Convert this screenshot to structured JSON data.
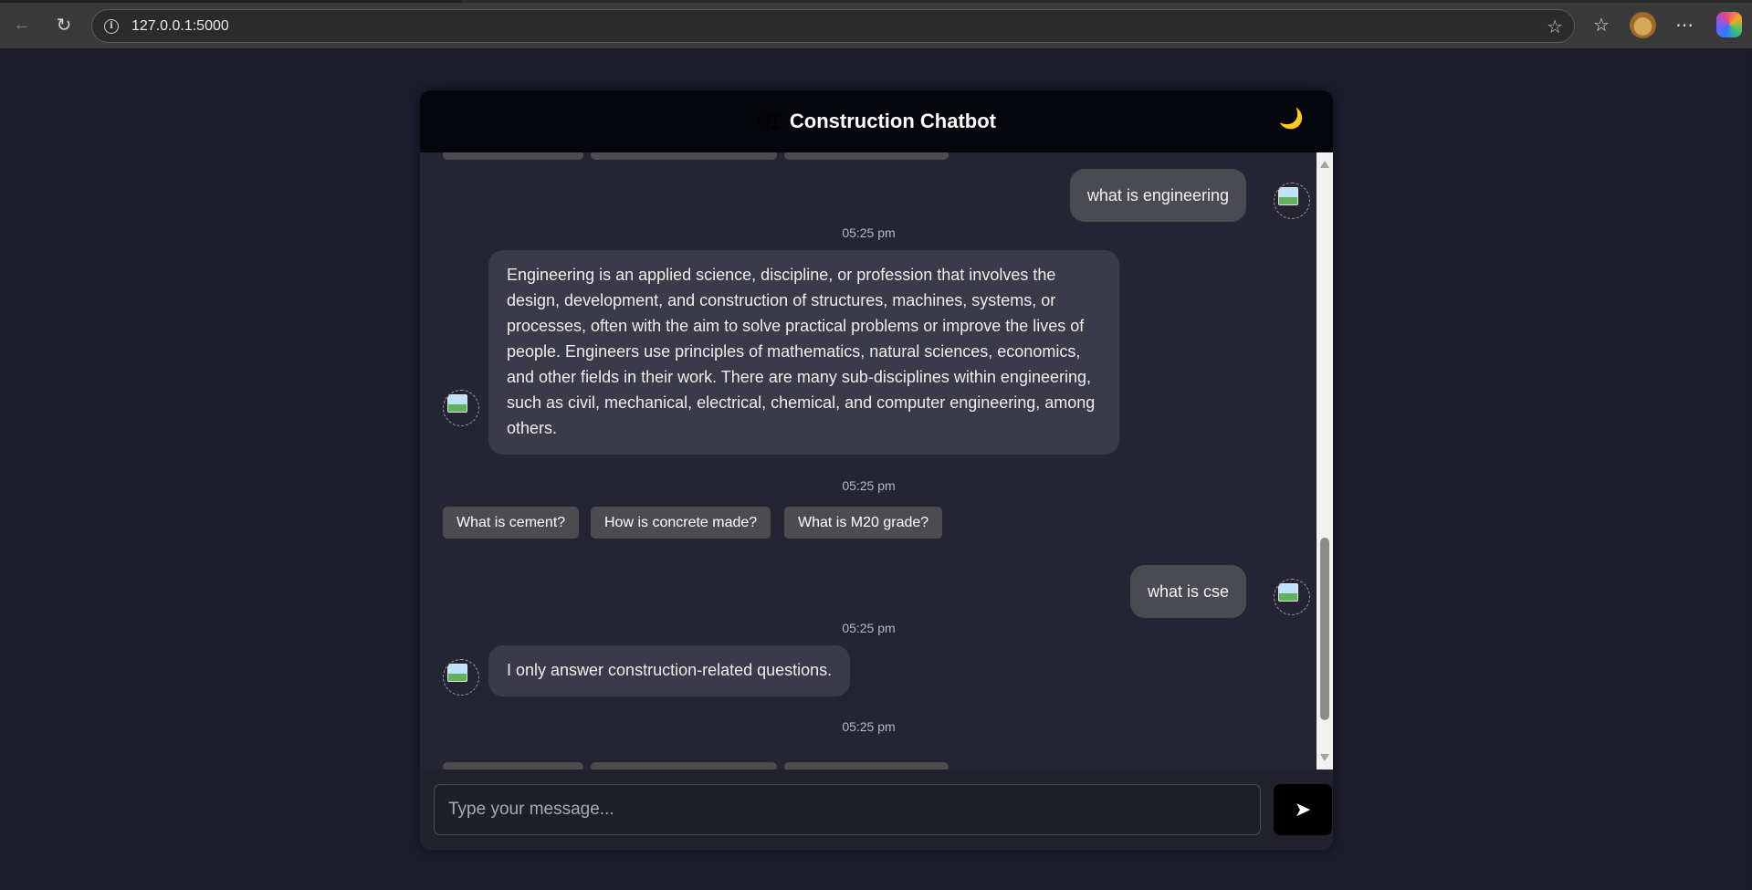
{
  "browser": {
    "url": "127.0.0.1:5000",
    "back_icon": "←",
    "reload_icon": "↻",
    "info_icon": "i",
    "star_icon": "☆",
    "favorites_icon": "☆",
    "more_icon": "⋯"
  },
  "header": {
    "logo_icon": "🏗",
    "title": "Construction Chatbot",
    "theme_toggle_icon": "🌙"
  },
  "messages": [
    {
      "type": "user",
      "text": "what is engineering"
    },
    {
      "type": "timestamp",
      "text": "05:25 pm"
    },
    {
      "type": "bot",
      "text": "Engineering is an applied science, discipline, or profession that involves the design, development, and construction of structures, machines, systems, or processes, often with the aim to solve practical problems or improve the lives of people. Engineers use principles of mathematics, natural sciences, economics, and other fields in their work. There are many sub-disciplines within engineering, such as civil, mechanical, electrical, chemical, and computer engineering, among others."
    },
    {
      "type": "timestamp",
      "text": "05:25 pm"
    },
    {
      "type": "user",
      "text": "what is cse"
    },
    {
      "type": "timestamp",
      "text": "05:25 pm"
    },
    {
      "type": "bot",
      "text": "I only answer construction-related questions."
    },
    {
      "type": "timestamp",
      "text": "05:25 pm"
    }
  ],
  "suggestions": [
    "What is cement?",
    "How is concrete made?",
    "What is M20 grade?"
  ],
  "input": {
    "placeholder": "Type your message...",
    "value": "",
    "send_icon": "➤"
  },
  "colors": {
    "page_bg": "#1c1c2c",
    "header_bg": "#05060b",
    "user_bubble": "#4a4a52",
    "bot_bubble": "#3a3a48",
    "suggestion_bg": "#4b4b50"
  }
}
